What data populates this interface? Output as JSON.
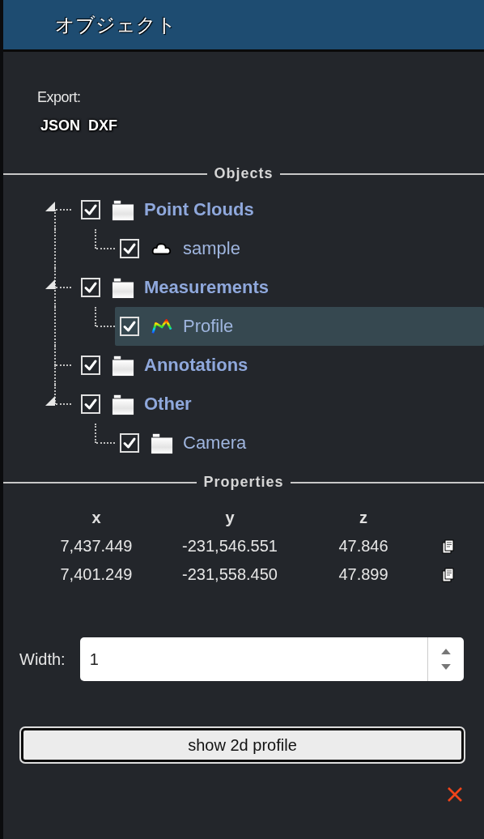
{
  "panel": {
    "title": "オブジェクト"
  },
  "export": {
    "label": "Export:",
    "formats": [
      "JSON",
      "DXF"
    ]
  },
  "objects": {
    "heading": "Objects",
    "tree": [
      {
        "label": "Point Clouds",
        "kind": "folder",
        "checked": true,
        "expanded": true,
        "selected": false,
        "children": [
          {
            "label": "sample",
            "kind": "point-cloud",
            "checked": true,
            "selected": false
          }
        ]
      },
      {
        "label": "Measurements",
        "kind": "folder",
        "checked": true,
        "expanded": true,
        "selected": false,
        "children": [
          {
            "label": "Profile",
            "kind": "profile",
            "checked": true,
            "selected": true
          }
        ]
      },
      {
        "label": "Annotations",
        "kind": "folder",
        "checked": true,
        "selected": false
      },
      {
        "label": "Other",
        "kind": "folder",
        "checked": true,
        "expanded": true,
        "selected": false,
        "children": [
          {
            "label": "Camera",
            "kind": "folder",
            "checked": true,
            "selected": false
          }
        ]
      }
    ]
  },
  "properties": {
    "heading": "Properties",
    "columns": [
      "x",
      "y",
      "z"
    ],
    "rows": [
      [
        "7,437.449",
        "-231,546.551",
        "47.846"
      ],
      [
        "7,401.249",
        "-231,558.450",
        "47.899"
      ]
    ],
    "width": {
      "label": "Width:",
      "value": "1"
    },
    "button": "show 2d profile"
  }
}
